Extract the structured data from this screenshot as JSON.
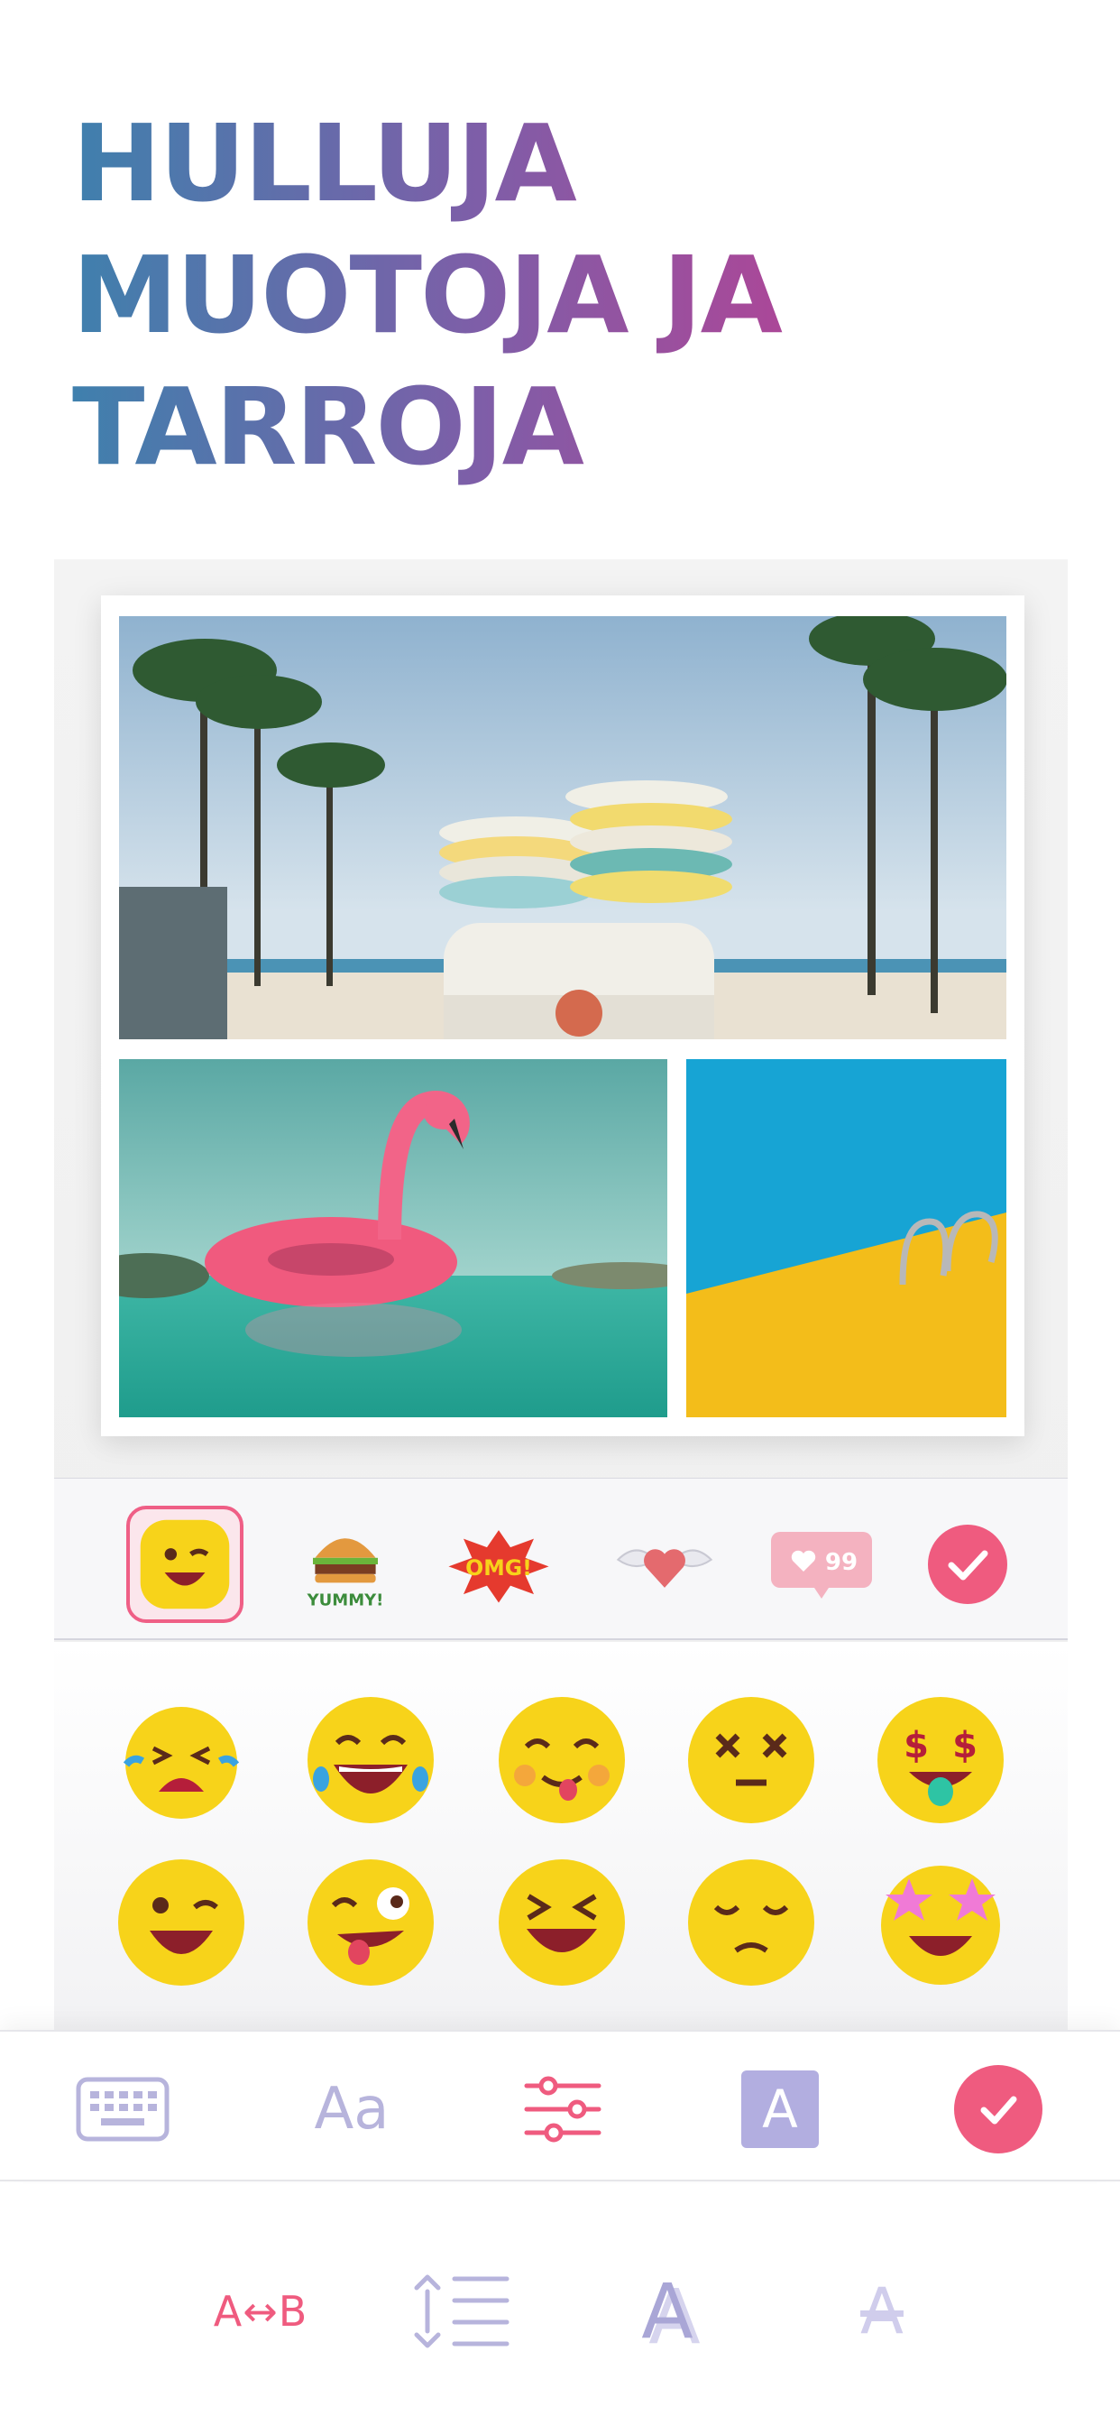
{
  "headline": {
    "line1": "HULLUJA",
    "line2": "MUOTOJA JA",
    "line3": "TARROJA"
  },
  "colors": {
    "gradient_start": "#3f80ad",
    "gradient_end": "#c7398e",
    "accent": "#ef5b7f",
    "tool_lavender": "#b2aee0"
  },
  "collage": {
    "photos": [
      "beach-van-surfboards-photo",
      "pink-flamingo-float-photo",
      "pool-ladder-photo"
    ]
  },
  "sticker_categories": {
    "items": [
      {
        "icon": "wink-emoji-icon",
        "selected": true
      },
      {
        "icon": "burger-yummy-sticker-icon",
        "label": "YUMMY!"
      },
      {
        "icon": "omg-sticker-icon",
        "label": "OMG!"
      },
      {
        "icon": "winged-heart-icon"
      },
      {
        "icon": "like-badge-icon",
        "label": "99"
      },
      {
        "icon": "confirm-check-icon"
      }
    ]
  },
  "emojis": [
    "crying-laughing-emoji",
    "tears-of-joy-emoji",
    "tongue-out-emoji",
    "dizzy-x-eyes-emoji",
    "money-mouth-emoji",
    "winking-emoji",
    "zany-emoji",
    "grinning-squint-emoji",
    "pensive-emoji",
    "star-struck-emoji"
  ],
  "toolbar": {
    "font_label": "Aa",
    "color_label": "A"
  },
  "text_tools": {
    "swap_label": "A↔B",
    "shadow_label": "A",
    "outline_label": "A"
  }
}
